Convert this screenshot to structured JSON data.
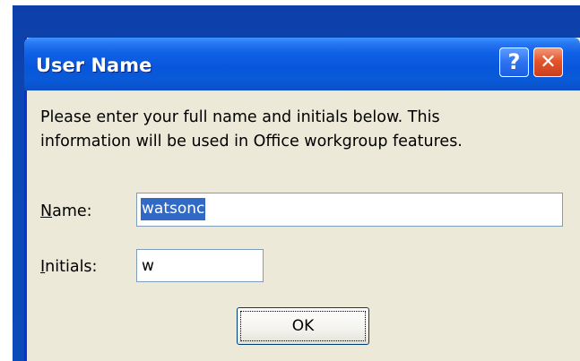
{
  "dialog": {
    "title": "User Name",
    "help_button_glyph": "?",
    "close_button_glyph": "✕",
    "message": "Please enter your full name and initials below.  This\ninformation will be used in Office workgroup features.",
    "name_label_mnemonic": "N",
    "name_label_rest": "ame:",
    "name_value": "watsonc",
    "initials_label_mnemonic": "I",
    "initials_label_rest": "nitials:",
    "initials_value": "w",
    "ok_label": "OK"
  },
  "colors": {
    "titlebar": "#0856dc",
    "dialog_face": "#ece9d8",
    "selection": "#316ac5",
    "close_button": "#e4542c",
    "desktop": "#0b4ab9"
  },
  "icons": {
    "help": "help-icon",
    "close": "close-icon"
  }
}
